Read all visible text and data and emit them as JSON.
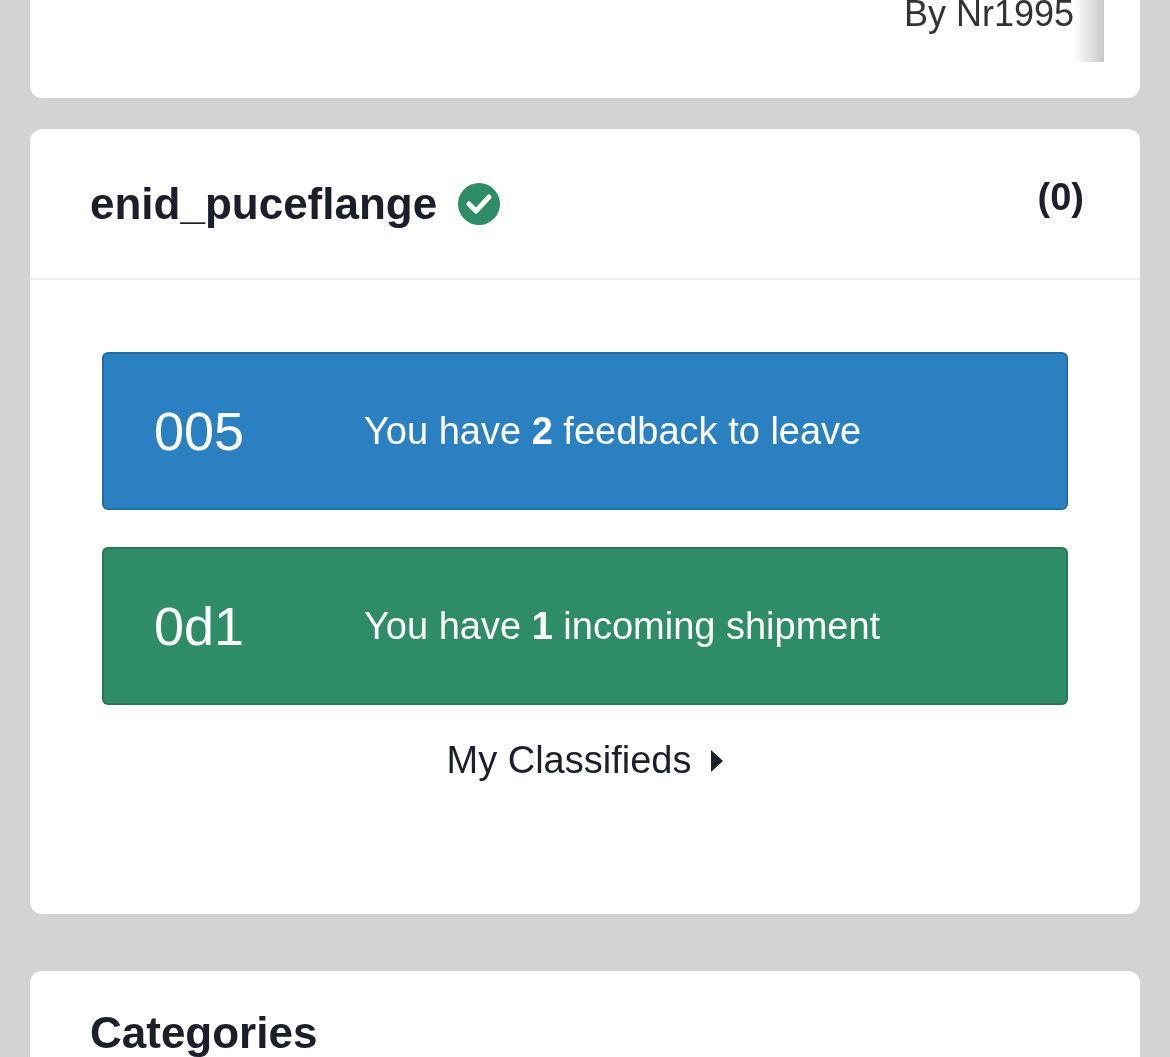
{
  "top_card": {
    "byline": "By Nr1995"
  },
  "user_card": {
    "username": "enid_puceflange",
    "verified": true,
    "count": "(0)",
    "alerts": [
      {
        "code": "005",
        "message": "You have **2** feedback to leave",
        "color": "#2b80c1"
      },
      {
        "code": "0d1",
        "message": "You have **1** incoming shipment",
        "color": "#2e8c69"
      }
    ],
    "link": "My Classifieds"
  },
  "categories_card": {
    "title": "Categories"
  }
}
